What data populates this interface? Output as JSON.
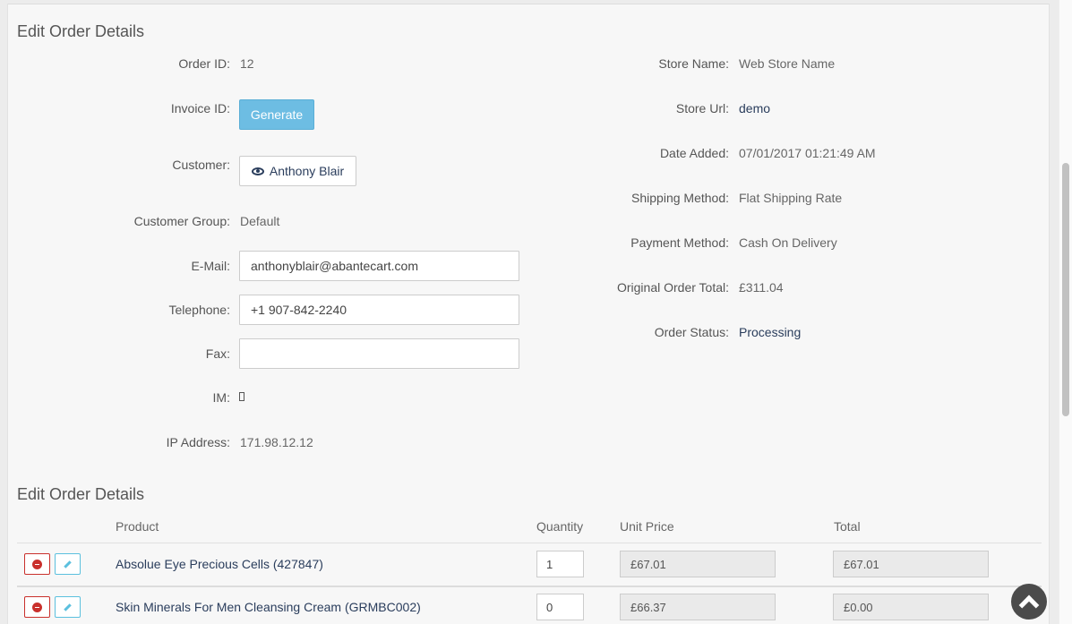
{
  "section_order": {
    "title": "Edit Order Details",
    "left_fields": {
      "order_id": {
        "label": "Order ID:",
        "value": "12"
      },
      "invoice_id": {
        "label": "Invoice ID:",
        "button": "Generate"
      },
      "customer": {
        "label": "Customer:",
        "button": "Anthony Blair"
      },
      "customer_group": {
        "label": "Customer Group:",
        "value": "Default"
      },
      "email": {
        "label": "E-Mail:",
        "value": "anthonyblair@abantecart.com"
      },
      "telephone": {
        "label": "Telephone:",
        "value": "+1 907-842-2240"
      },
      "fax": {
        "label": "Fax:",
        "value": ""
      },
      "im": {
        "label": "IM:"
      },
      "ip_address": {
        "label": "IP Address:",
        "value": "171.98.12.12"
      }
    },
    "right_fields": {
      "store_name": {
        "label": "Store Name:",
        "value": "Web Store Name"
      },
      "store_url": {
        "label": "Store Url:",
        "value": "demo"
      },
      "date_added": {
        "label": "Date Added:",
        "value": "07/01/2017 01:21:49 AM"
      },
      "shipping_method": {
        "label": "Shipping Method:",
        "value": "Flat Shipping Rate"
      },
      "payment_method": {
        "label": "Payment Method:",
        "value": "Cash On Delivery"
      },
      "original_total": {
        "label": "Original Order Total:",
        "value": "£311.04"
      },
      "order_status": {
        "label": "Order Status:",
        "value": "Processing"
      }
    }
  },
  "section_products": {
    "title": "Edit Order Details",
    "columns": {
      "product": "Product",
      "quantity": "Quantity",
      "unit_price": "Unit Price",
      "total": "Total"
    },
    "rows": [
      {
        "product": "Absolue Eye Precious Cells (427847)",
        "quantity": "1",
        "unit_price": "£67.01",
        "total": "£67.01"
      },
      {
        "product": "Skin Minerals For Men Cleansing Cream (GRMBC002)",
        "quantity": "0",
        "unit_price": "£66.37",
        "total": "£0.00"
      }
    ]
  },
  "icons": {
    "remove": "minus-circle-icon",
    "edit": "pencil-icon",
    "view": "eye-icon",
    "scroll_top": "chevron-up-icon"
  },
  "colors": {
    "accent": "#6dbde3",
    "link": "#2a3d5c",
    "danger": "#c9302c",
    "info": "#5bc0de"
  }
}
